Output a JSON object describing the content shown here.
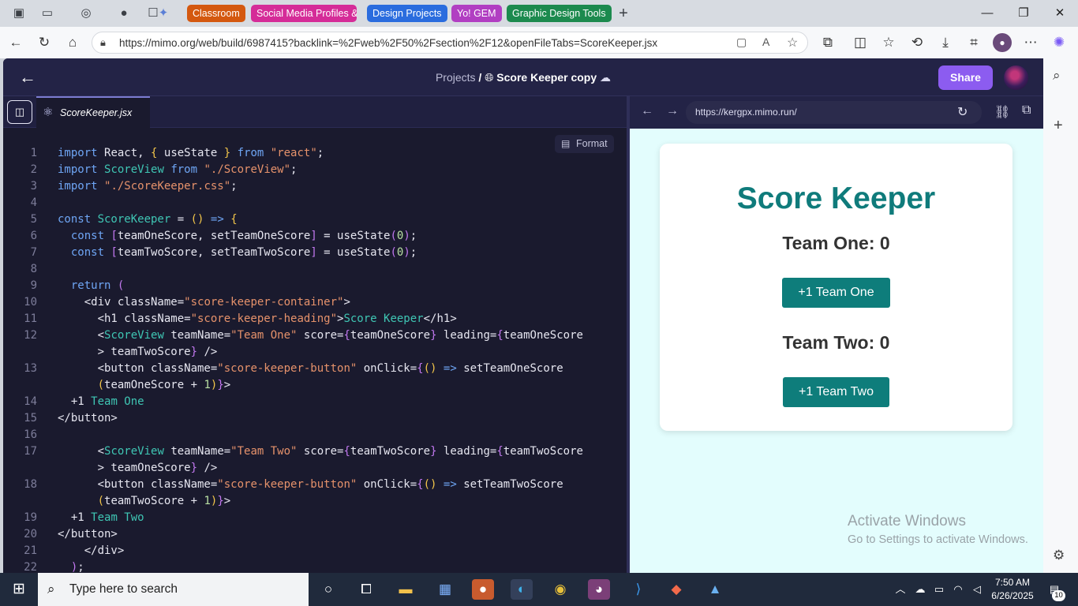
{
  "browser": {
    "tab_groups": [
      {
        "label": "Classroom",
        "color": "#d4580f"
      },
      {
        "label": "Social Media Profiles &",
        "color": "#d52c98"
      },
      {
        "label": "Design Projects",
        "color": "#2a6cde"
      },
      {
        "label": "Yo! GEM",
        "color": "#b13ec2"
      },
      {
        "label": "Graphic Design Tools",
        "color": "#1c8a4e"
      }
    ],
    "url": "https://mimo.org/web/build/6987415?backlink=%2Fweb%2F50%2Fsection%2F12&openFileTabs=ScoreKeeper.jsx"
  },
  "app": {
    "breadcrumb_root": "Projects",
    "separator": "/",
    "project_name": "Score Keeper copy",
    "share_label": "Share",
    "file_tab": "ScoreKeeper.jsx",
    "format_label": "Format",
    "preview_url": "https://kergpx.mimo.run/"
  },
  "code_lines": [
    {
      "n": "1",
      "tokens": [
        [
          "k",
          "import "
        ],
        [
          "v",
          "React"
        ],
        [
          "v",
          ", "
        ],
        [
          "p",
          "{ "
        ],
        [
          "v",
          "useState "
        ],
        [
          "p",
          "} "
        ],
        [
          "k",
          "from "
        ],
        [
          "s",
          "\"react\""
        ],
        [
          "v",
          ";"
        ]
      ]
    },
    {
      "n": "2",
      "tokens": [
        [
          "k",
          "import "
        ],
        [
          "t",
          "ScoreView "
        ],
        [
          "k",
          "from "
        ],
        [
          "s",
          "\"./ScoreView\""
        ],
        [
          "v",
          ";"
        ]
      ]
    },
    {
      "n": "3",
      "tokens": [
        [
          "k",
          "import "
        ],
        [
          "s",
          "\"./ScoreKeeper.css\""
        ],
        [
          "v",
          ";"
        ]
      ]
    },
    {
      "n": "4",
      "tokens": []
    },
    {
      "n": "5",
      "tokens": [
        [
          "k",
          "const "
        ],
        [
          "t",
          "ScoreKeeper "
        ],
        [
          "v",
          "= "
        ],
        [
          "p",
          "() "
        ],
        [
          "k",
          "=> "
        ],
        [
          "p",
          "{"
        ]
      ]
    },
    {
      "n": "6",
      "tokens": [
        [
          "v",
          "  "
        ],
        [
          "k",
          "const "
        ],
        [
          "b",
          "["
        ],
        [
          "v",
          "teamOneScore, setTeamOneScore"
        ],
        [
          "b",
          "] "
        ],
        [
          "v",
          "= useState"
        ],
        [
          "b",
          "("
        ],
        [
          "n",
          "0"
        ],
        [
          "b",
          ")"
        ],
        [
          "v",
          ";"
        ]
      ]
    },
    {
      "n": "7",
      "tokens": [
        [
          "v",
          "  "
        ],
        [
          "k",
          "const "
        ],
        [
          "b",
          "["
        ],
        [
          "v",
          "teamTwoScore, setTeamTwoScore"
        ],
        [
          "b",
          "] "
        ],
        [
          "v",
          "= useState"
        ],
        [
          "b",
          "("
        ],
        [
          "n",
          "0"
        ],
        [
          "b",
          ")"
        ],
        [
          "v",
          ";"
        ]
      ]
    },
    {
      "n": "8",
      "tokens": []
    },
    {
      "n": "9",
      "tokens": [
        [
          "v",
          "  "
        ],
        [
          "k",
          "return "
        ],
        [
          "b",
          "("
        ]
      ]
    },
    {
      "n": "10",
      "tokens": [
        [
          "v",
          "    <div className="
        ],
        [
          "s",
          "\"score-keeper-container\""
        ],
        [
          "v",
          ">"
        ]
      ]
    },
    {
      "n": "11",
      "tokens": [
        [
          "v",
          "      <h1 className="
        ],
        [
          "s",
          "\"score-keeper-heading\""
        ],
        [
          "v",
          ">"
        ],
        [
          "t",
          "Score Keeper"
        ],
        [
          "v",
          "</h1>"
        ]
      ]
    },
    {
      "n": "12",
      "tokens": [
        [
          "v",
          "      <"
        ],
        [
          "t",
          "ScoreView "
        ],
        [
          "v",
          "teamName="
        ],
        [
          "s",
          "\"Team One\" "
        ],
        [
          "v",
          "score="
        ],
        [
          "b",
          "{"
        ],
        [
          "v",
          "teamOneScore"
        ],
        [
          "b",
          "} "
        ],
        [
          "v",
          "leading="
        ],
        [
          "b",
          "{"
        ],
        [
          "v",
          "teamOneScore"
        ]
      ]
    },
    {
      "n": "",
      "tokens": [
        [
          "v",
          "      > teamTwoScore"
        ],
        [
          "b",
          "} "
        ],
        [
          "v",
          "/>"
        ]
      ]
    },
    {
      "n": "13",
      "tokens": [
        [
          "v",
          "      <button className="
        ],
        [
          "s",
          "\"score-keeper-button\" "
        ],
        [
          "v",
          "onClick="
        ],
        [
          "b",
          "{"
        ],
        [
          "p",
          "() "
        ],
        [
          "k",
          "=> "
        ],
        [
          "v",
          "setTeamOneScore"
        ]
      ]
    },
    {
      "n": "",
      "tokens": [
        [
          "v",
          "      "
        ],
        [
          "p",
          "("
        ],
        [
          "v",
          "teamOneScore + "
        ],
        [
          "n",
          "1"
        ],
        [
          "p",
          ")"
        ],
        [
          "b",
          "}"
        ],
        [
          "v",
          ">"
        ]
      ]
    },
    {
      "n": "14",
      "tokens": [
        [
          "v",
          "  +1 "
        ],
        [
          "t",
          "Team One"
        ]
      ]
    },
    {
      "n": "15",
      "tokens": [
        [
          "v",
          "</button>"
        ]
      ]
    },
    {
      "n": "16",
      "tokens": []
    },
    {
      "n": "17",
      "tokens": [
        [
          "v",
          "      <"
        ],
        [
          "t",
          "ScoreView "
        ],
        [
          "v",
          "teamName="
        ],
        [
          "s",
          "\"Team Two\" "
        ],
        [
          "v",
          "score="
        ],
        [
          "b",
          "{"
        ],
        [
          "v",
          "teamTwoScore"
        ],
        [
          "b",
          "} "
        ],
        [
          "v",
          "leading="
        ],
        [
          "b",
          "{"
        ],
        [
          "v",
          "teamTwoScore"
        ]
      ]
    },
    {
      "n": "",
      "tokens": [
        [
          "v",
          "      > teamOneScore"
        ],
        [
          "b",
          "} "
        ],
        [
          "v",
          "/>"
        ]
      ]
    },
    {
      "n": "18",
      "tokens": [
        [
          "v",
          "      <button className="
        ],
        [
          "s",
          "\"score-keeper-button\" "
        ],
        [
          "v",
          "onClick="
        ],
        [
          "b",
          "{"
        ],
        [
          "p",
          "() "
        ],
        [
          "k",
          "=> "
        ],
        [
          "v",
          "setTeamTwoScore"
        ]
      ]
    },
    {
      "n": "",
      "tokens": [
        [
          "v",
          "      "
        ],
        [
          "p",
          "("
        ],
        [
          "v",
          "teamTwoScore + "
        ],
        [
          "n",
          "1"
        ],
        [
          "p",
          ")"
        ],
        [
          "b",
          "}"
        ],
        [
          "v",
          ">"
        ]
      ]
    },
    {
      "n": "19",
      "tokens": [
        [
          "v",
          "  +1 "
        ],
        [
          "t",
          "Team Two"
        ]
      ]
    },
    {
      "n": "20",
      "tokens": [
        [
          "v",
          "</button>"
        ]
      ]
    },
    {
      "n": "21",
      "tokens": [
        [
          "v",
          "    </div>"
        ]
      ]
    },
    {
      "n": "22",
      "tokens": [
        [
          "v",
          "  "
        ],
        [
          "b",
          ")"
        ],
        [
          "v",
          ";"
        ]
      ]
    }
  ],
  "preview": {
    "title": "Score Keeper",
    "team_one_label": "Team One: 0",
    "team_one_button": "+1 Team One",
    "team_two_label": "Team Two: 0",
    "team_two_button": "+1 Team Two",
    "activate_title": "Activate Windows",
    "activate_sub": "Go to Settings to activate Windows."
  },
  "taskbar": {
    "search_placeholder": "Type here to search",
    "time": "7:50 AM",
    "date": "6/26/2025",
    "notification_count": "10"
  }
}
